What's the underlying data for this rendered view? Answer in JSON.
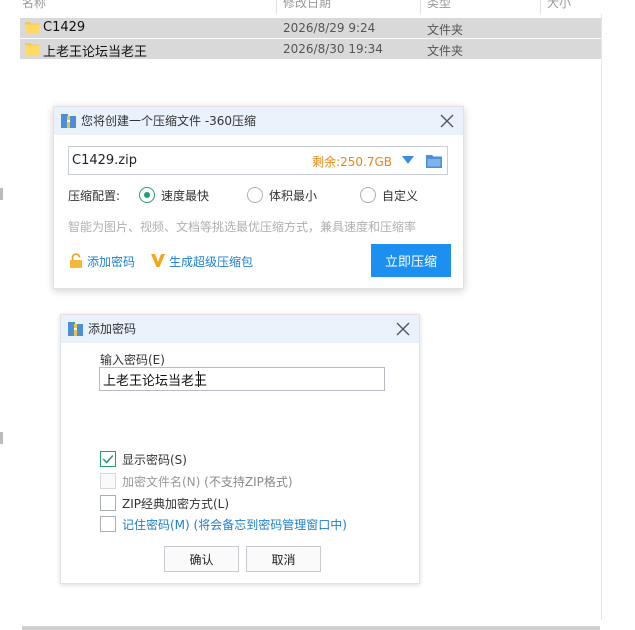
{
  "explorer": {
    "columns": [
      "名称",
      "修改日期",
      "类型",
      "大小"
    ],
    "files": [
      {
        "name": "C1429",
        "date": "2026/8/29 9:24",
        "type": "文件夹"
      },
      {
        "name": "上老王论坛当老王",
        "date": "2026/8/30 19:34",
        "type": "文件夹"
      }
    ]
  },
  "compress_dialog": {
    "title": "您将创建一个压缩文件 -360压缩",
    "filename": "C1429.zip",
    "remaining": "剩余:250.7GB",
    "config_label": "压缩配置:",
    "options": [
      "速度最快",
      "体积最小",
      "自定义"
    ],
    "selected_option": "速度最快",
    "hint": "智能为图片、视频、文档等挑选最优压缩方式，兼具速度和压缩率",
    "add_password": "添加密码",
    "super_package": "生成超级压缩包",
    "compress_button": "立即压缩"
  },
  "password_dialog": {
    "title": "添加密码",
    "input_label": "输入密码(E)",
    "password_value": "上老王论坛当老王",
    "show_password": {
      "label": "显示密码(S)",
      "checked": true
    },
    "encrypt_filenames": {
      "label": "加密文件名(N)",
      "note": "(不支持ZIP格式)",
      "checked": false,
      "disabled": true
    },
    "zip_classic": {
      "label": "ZIP经典加密方式(L)",
      "checked": false
    },
    "remember": {
      "label": "记住密码(M)",
      "note": "(将会备忘到密码管理窗口中)",
      "checked": false
    },
    "ok_button": "确认",
    "cancel_button": "取消"
  },
  "colors": {
    "accent_blue": "#1c8ff0",
    "link_blue": "#1d7fd1",
    "remaining_orange": "#e8870e",
    "check_green": "#22a06b",
    "titlebar_bg": "#e9f1fb",
    "folder_yellow": "#f6c94a"
  },
  "icons": {
    "folder": "folder-icon",
    "archive": "archive-icon",
    "close": "close-icon",
    "dropdown": "chevron-down-icon",
    "browse": "folder-open-icon",
    "lock": "lock-icon",
    "super": "v-badge-icon",
    "check": "checkmark-icon"
  }
}
